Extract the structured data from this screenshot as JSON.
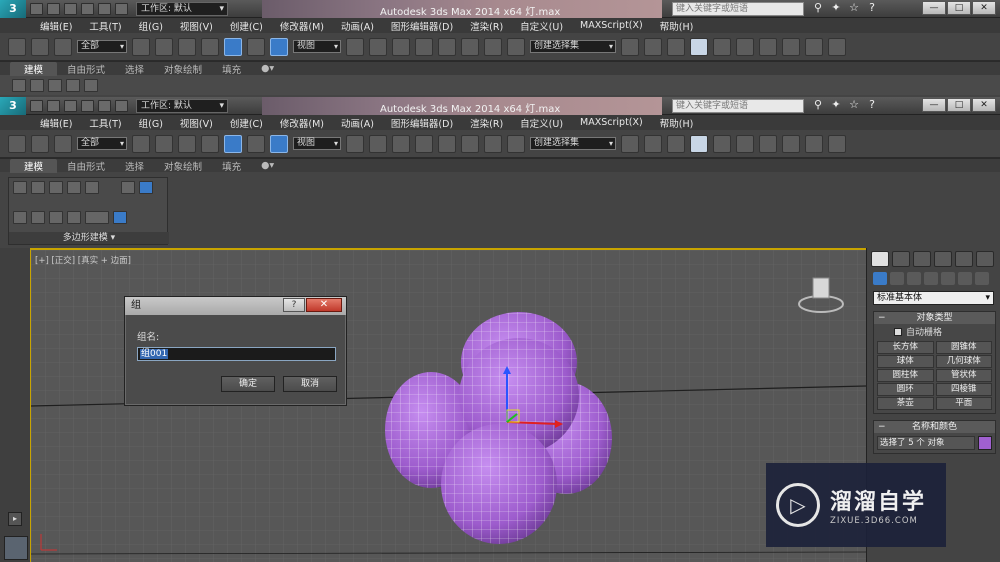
{
  "windows": [
    {
      "workspace": "工作区: 默认",
      "title": "Autodesk 3ds Max  2014 x64     灯.max",
      "search_placeholder": "键入关键字或短语",
      "menu": [
        "编辑(E)",
        "工具(T)",
        "组(G)",
        "视图(V)",
        "创建(C)",
        "修改器(M)",
        "动画(A)",
        "图形编辑器(D)",
        "渲染(R)",
        "自定义(U)",
        "MAXScript(X)",
        "帮助(H)"
      ],
      "toolbar": {
        "filter": "全部",
        "view": "视图",
        "selection_set": "创建选择集"
      },
      "ribbon_tabs": [
        "建模",
        "自由形式",
        "选择",
        "对象绘制",
        "填充"
      ]
    },
    {
      "workspace": "工作区: 默认",
      "title": "Autodesk 3ds Max  2014 x64     灯.max",
      "search_placeholder": "键入关键字或短语",
      "menu": [
        "编辑(E)",
        "工具(T)",
        "组(G)",
        "视图(V)",
        "创建(C)",
        "修改器(M)",
        "动画(A)",
        "图形编辑器(D)",
        "渲染(R)",
        "自定义(U)",
        "MAXScript(X)",
        "帮助(H)"
      ],
      "toolbar": {
        "filter": "全部",
        "view": "视图",
        "selection_set": "创建选择集"
      },
      "ribbon_tabs": [
        "建模",
        "自由形式",
        "选择",
        "对象绘制",
        "填充"
      ]
    }
  ],
  "ribbon_panel_label": "多边形建模 ▾",
  "viewport": {
    "label": "[+] [正交] [真实 + 边面]"
  },
  "command_panel": {
    "category": "标准基本体",
    "object_type_header": "对象类型",
    "autogrid": "自动栅格",
    "objects": [
      "长方体",
      "圆锥体",
      "球体",
      "几何球体",
      "圆柱体",
      "管状体",
      "圆环",
      "四棱锥",
      "茶壶",
      "平面"
    ],
    "name_color_header": "名称和颜色",
    "name_value": "选择了 5 个 对象",
    "object_color": "#a060d0"
  },
  "dialog": {
    "title": "组",
    "label": "组名:",
    "value": "组001",
    "ok": "确定",
    "cancel": "取消"
  },
  "watermark": {
    "name": "溜溜自学",
    "url": "ZIXUE.3D66.COM"
  },
  "colors": {
    "accent": "#3a7bc8",
    "viewport_border": "#c8a400",
    "sphere": "#a464d4"
  }
}
